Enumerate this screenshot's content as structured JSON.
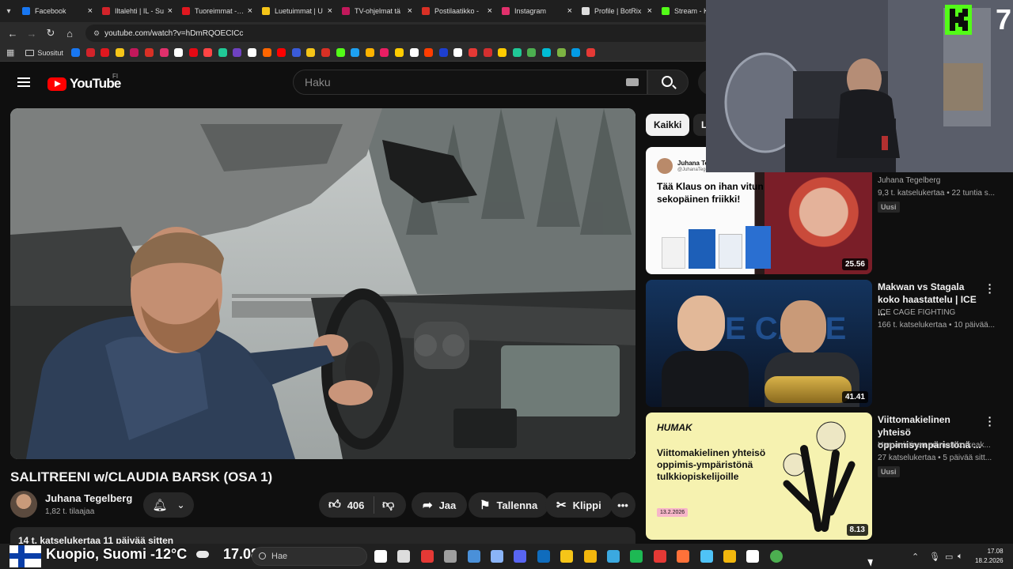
{
  "browser": {
    "tabs": [
      {
        "label": "Facebook",
        "color": "#1877f2"
      },
      {
        "label": "Iltalehti | IL - Su",
        "color": "#d2232a"
      },
      {
        "label": "Tuoreimmat - IS",
        "color": "#e0171f"
      },
      {
        "label": "Luetuimmat | U",
        "color": "#f5c518"
      },
      {
        "label": "TV-ohjelmat tä",
        "color": "#c2185b"
      },
      {
        "label": "Postilaatikko -",
        "color": "#d93025"
      },
      {
        "label": "Instagram",
        "color": "#e1306c"
      },
      {
        "label": "Profile | BotRix",
        "color": "#dddddd"
      },
      {
        "label": "Stream - Ki",
        "color": "#53fc18"
      }
    ],
    "url": "youtube.com/watch?v=hDmRQOECICc",
    "bookmarks_folder": "Suositut",
    "bookmark_colors": [
      "#1877f2",
      "#d2232a",
      "#e0171f",
      "#f5c518",
      "#c2185b",
      "#d93025",
      "#e1306c",
      "#ffffff",
      "#e50914",
      "#ff4444",
      "#20c997",
      "#6f42c1",
      "#ffffff",
      "#ff6600",
      "#ff0000",
      "#3a5bd9",
      "#f5c518",
      "#d93025",
      "#53fc18",
      "#1da1f2",
      "#ffb300",
      "#e91e63",
      "#ffcc00",
      "#ffffff",
      "#ff3d00",
      "#1d3fd1",
      "#ffffff",
      "#e53935",
      "#d32f2f",
      "#ffcc00",
      "#20c997",
      "#4caf50",
      "#00bcd4",
      "#7cb342",
      "#039be5",
      "#e53935"
    ]
  },
  "youtube": {
    "logo_text": "YouTube",
    "country_code": "FI",
    "search_placeholder": "Haku",
    "video": {
      "title": "SALITREENI w/CLAUDIA BARSK (OSA 1)",
      "channel": "Juhana Tegelberg",
      "subscribers": "1,82 t. tilaajaa",
      "likes": "406",
      "share_label": "Jaa",
      "save_label": "Tallenna",
      "clip_label": "Klippi",
      "description_stats": "14 t. katselukertaa  11 päivää sitten"
    },
    "chips": [
      "Kaikki",
      "L"
    ],
    "recommendations": [
      {
        "title": "",
        "thumb_text": "Tää Klaus on ihan vitun sekopäinen friikki!",
        "thumb_handle": "@JuhanaTegelberg",
        "channel": "Juhana Tegelberg",
        "meta": "9,3 t. katselukertaa • 22 tuntia s...",
        "badge": "Uusi",
        "duration": "25.56"
      },
      {
        "title": "Makwan vs Stagala koko haastattelu | ICE ...",
        "channel": "ICE CAGE FIGHTING",
        "meta": "166 t. katselukertaa • 10 päivää...",
        "badge": "",
        "duration": "41.41"
      },
      {
        "title": "Viittomakielinen yhteisö oppimisympäristönä ...",
        "channel": "Humanistinen ammattikorkeak...",
        "meta": "27 katselukertaa • 5 päivää sitt...",
        "badge": "Uusi",
        "duration": "8.13",
        "thumb_brand": "HUMAK",
        "thumb_text": "Viittomakielinen yhteisö oppimis-ympäristönä tulkkiopiskelijoille",
        "thumb_date": "13.2.2026"
      }
    ]
  },
  "overlay": {
    "badge_number": "7"
  },
  "taskbar": {
    "weather": "Kuopio, Suomi -12°C",
    "time_big": "17.08",
    "search_placeholder": "Hae",
    "clock_time": "17.08",
    "clock_date": "18.2.2026",
    "app_icons": [
      "chart-icon",
      "copilot-icon",
      "chrome-canary-icon",
      "notepad-icon",
      "calculator-icon",
      "settings-icon",
      "discord-icon",
      "outlook-icon",
      "edge-beta-icon",
      "files-icon",
      "edge-icon",
      "spotify-icon",
      "snipping-icon",
      "firefox-icon",
      "task-view-icon",
      "explorer-icon",
      "steam-icon",
      "chrome-icon"
    ],
    "app_colors": [
      "#ffffff",
      "#dddddd",
      "#e53935",
      "#9e9e9e",
      "#4a90d9",
      "#8ab4f8",
      "#5865f2",
      "#0f6cbd",
      "#f5c518",
      "#f2b70d",
      "#3ba9e0",
      "#1db954",
      "#e53935",
      "#ff7139",
      "#4fc3f7",
      "#f2b70d",
      "#ffffff",
      "#4caf50"
    ]
  }
}
